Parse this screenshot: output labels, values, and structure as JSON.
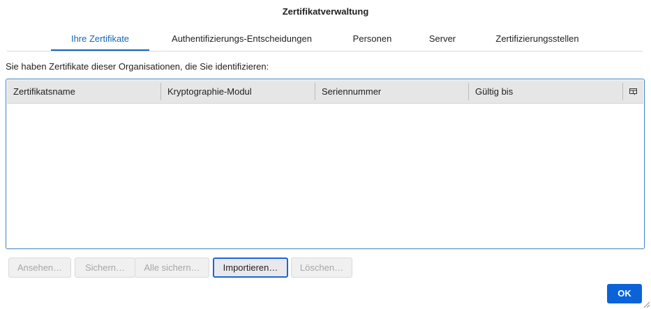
{
  "dialog": {
    "title": "Zertifikatverwaltung"
  },
  "tabs": [
    {
      "label": "Ihre Zertifikate",
      "selected": true
    },
    {
      "label": "Authentifizierungs-Entscheidungen",
      "selected": false
    },
    {
      "label": "Personen",
      "selected": false
    },
    {
      "label": "Server",
      "selected": false
    },
    {
      "label": "Zertifizierungsstellen",
      "selected": false
    }
  ],
  "intro_text": "Sie haben Zertifikate dieser Organisationen, die Sie identifizieren:",
  "table": {
    "columns": [
      "Zertifikatsname",
      "Kryptographie-Modul",
      "Seriennummer",
      "Gültig bis"
    ],
    "column_picker_icon": "column-picker-icon",
    "rows": []
  },
  "buttons": [
    {
      "label": "Ansehen…",
      "enabled": false
    },
    {
      "label": "Sichern…",
      "enabled": false
    },
    {
      "label": "Alle sichern…",
      "enabled": false
    },
    {
      "label": "Importieren…",
      "enabled": true
    },
    {
      "label": "Löschen…",
      "enabled": false
    }
  ],
  "ok_button": {
    "label": "OK"
  },
  "colors": {
    "accent": "#1565c0",
    "focus_ring": "#1a66d6",
    "ok_background": "#0b63d9"
  }
}
